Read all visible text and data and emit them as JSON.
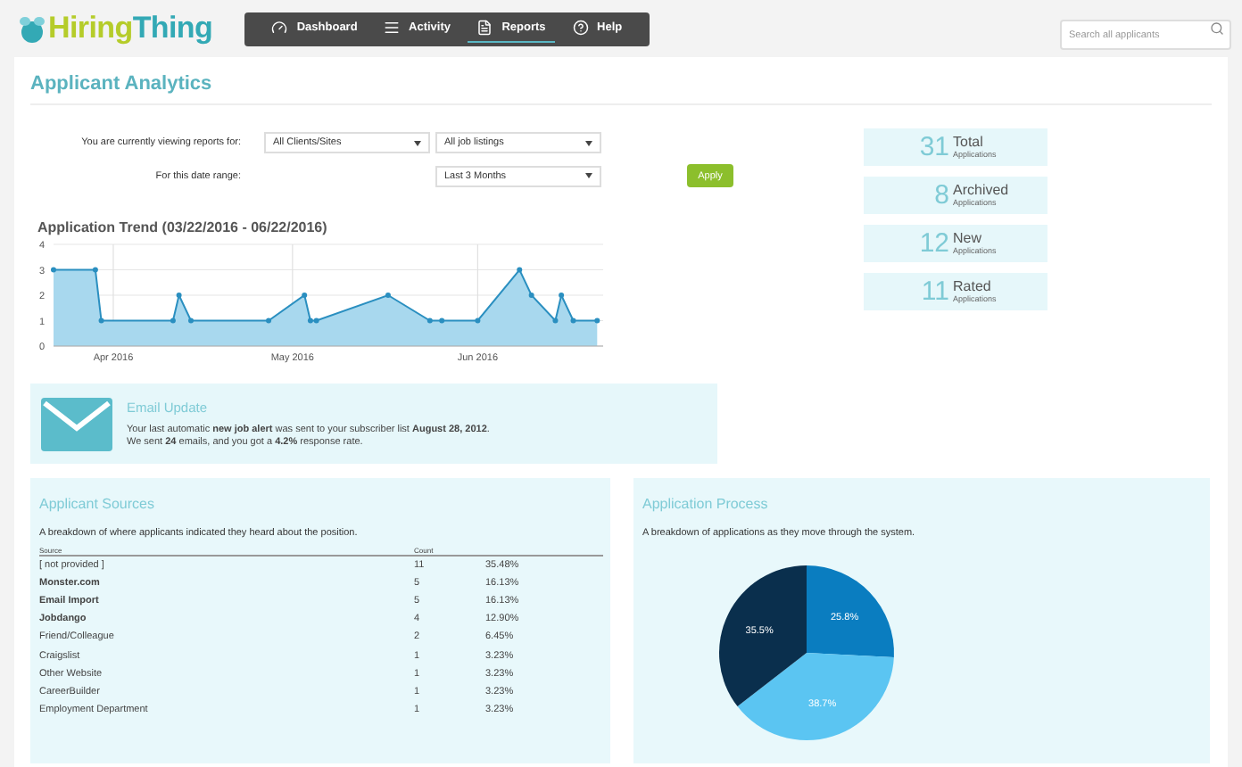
{
  "header": {
    "logo": {
      "first": "Hiring",
      "second": "Thing"
    },
    "nav": [
      {
        "label": "Dashboard",
        "kind": "gauge",
        "selected": false
      },
      {
        "label": "Activity",
        "kind": "list",
        "selected": false
      },
      {
        "label": "Reports",
        "kind": "document",
        "selected": true
      },
      {
        "label": "Help",
        "kind": "help",
        "selected": false
      }
    ],
    "search": {
      "placeholder": "Search all applicants"
    }
  },
  "page_title": "Applicant Analytics",
  "filters": {
    "rows": [
      {
        "label": "You are currently viewing reports for:",
        "selects": [
          "All Clients/Sites",
          "All job listings"
        ]
      },
      {
        "label": "For this date range:",
        "selects": [
          "Last 3 Months"
        ]
      }
    ],
    "apply": "Apply"
  },
  "trend": {
    "title": "Application Trend (03/22/2016 - 06/22/2016)",
    "chart_data": {
      "type": "area",
      "x": [
        "2016-03-22",
        "2016-03-29",
        "2016-03-30",
        "2016-04-11",
        "2016-04-12",
        "2016-04-14",
        "2016-04-27",
        "2016-05-03",
        "2016-05-04",
        "2016-05-05",
        "2016-05-17",
        "2016-05-24",
        "2016-05-26",
        "2016-06-01",
        "2016-06-08",
        "2016-06-10",
        "2016-06-14",
        "2016-06-15",
        "2016-06-17",
        "2016-06-21"
      ],
      "grid": true,
      "series": [
        {
          "color": "#2a8fc0",
          "values": [
            3,
            3,
            1,
            1,
            2,
            1,
            1,
            2,
            1,
            1,
            2,
            1,
            1,
            1,
            3,
            2,
            1,
            2,
            1,
            1
          ]
        }
      ],
      "xlim": [
        "2016-03-22",
        "2016-06-22"
      ],
      "ylim": [
        0,
        4
      ],
      "yticks": [
        0,
        1,
        2,
        3,
        4
      ],
      "xticks": [
        {
          "value": "2016-04-01",
          "label": "Apr 2016"
        },
        {
          "value": "2016-05-01",
          "label": "May 2016"
        },
        {
          "value": "2016-06-01",
          "label": "Jun 2016"
        }
      ]
    }
  },
  "stats": [
    {
      "number": "31",
      "label": "Total",
      "sub": "Applications"
    },
    {
      "number": "8",
      "label": "Archived",
      "sub": "Applications"
    },
    {
      "number": "12",
      "label": "New",
      "sub": "Applications"
    },
    {
      "number": "11",
      "label": "Rated",
      "sub": "Applications"
    }
  ],
  "email": {
    "title": "Email Update",
    "lines": [
      "Your last automatic **new job alert** was sent to your subscriber list **August 28, 2012**.",
      "We sent **24** emails, and you got a **4.2%** response rate."
    ]
  },
  "sources": {
    "title": "Applicant Sources",
    "description": "A breakdown of where applicants indicated they heard about the position.",
    "columns": [
      "Source",
      "Count"
    ],
    "rows": [
      {
        "source": "[ not provided ]",
        "count": "11",
        "percent": "35.48%",
        "bold": false
      },
      {
        "source": "Monster.com",
        "count": "5",
        "percent": "16.13%",
        "bold": true
      },
      {
        "source": "Email Import",
        "count": "5",
        "percent": "16.13%",
        "bold": true
      },
      {
        "source": "Jobdango",
        "count": "4",
        "percent": "12.90%",
        "bold": true
      },
      {
        "source": "Friend/Colleague",
        "count": "2",
        "percent": "6.45%",
        "bold": false
      },
      {
        "source": "Craigslist",
        "count": "1",
        "percent": "3.23%",
        "bold": false
      },
      {
        "source": "Other Website",
        "count": "1",
        "percent": "3.23%",
        "bold": false
      },
      {
        "source": "CareerBuilder",
        "count": "1",
        "percent": "3.23%",
        "bold": false
      },
      {
        "source": "Employment Department",
        "count": "1",
        "percent": "3.23%",
        "bold": false
      }
    ]
  },
  "process": {
    "title": "Application Process",
    "description": "A breakdown of applications as they move through the system.",
    "chart_data": {
      "type": "pie",
      "values": [
        25.8,
        38.7,
        35.5
      ],
      "value_labels": [
        "25.8%",
        "38.7%",
        "35.5%"
      ]
    }
  }
}
